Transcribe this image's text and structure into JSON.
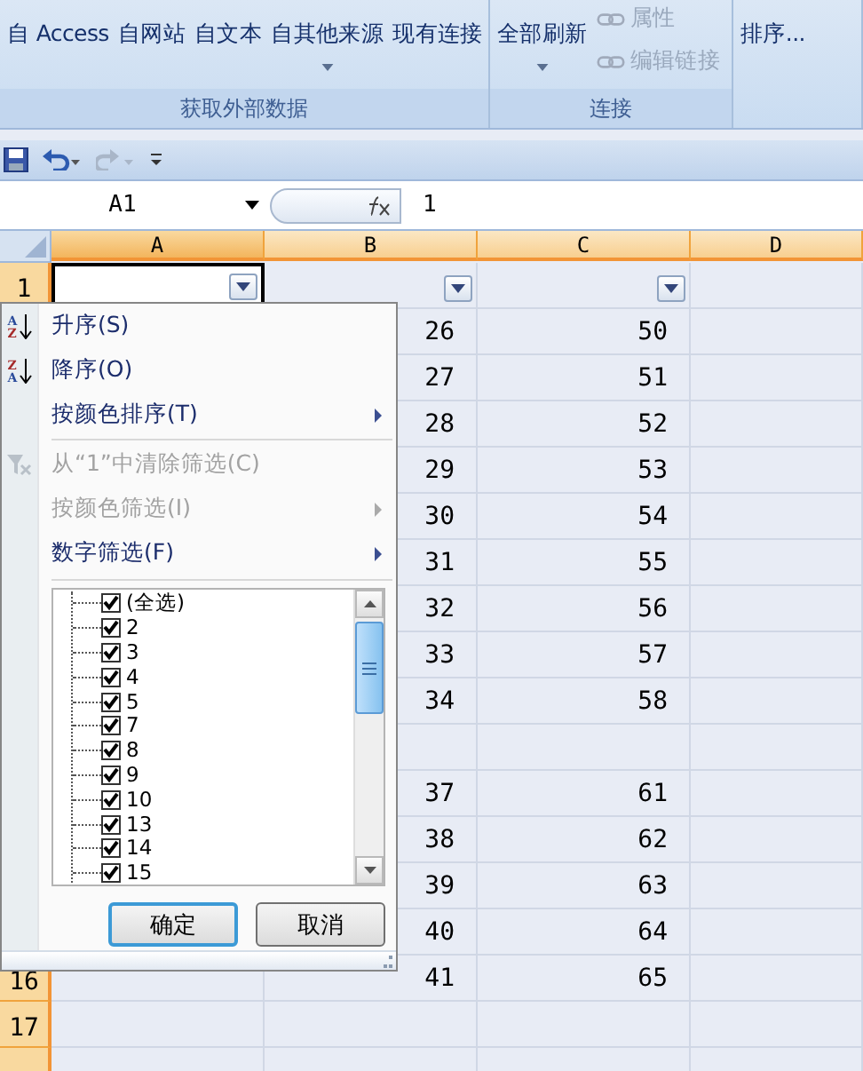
{
  "ribbon": {
    "groups": [
      {
        "label": "获取外部数据",
        "buttons": [
          {
            "label": "自 Access",
            "disabled": false,
            "dropdown": false
          },
          {
            "label": "自网站",
            "disabled": false,
            "dropdown": false
          },
          {
            "label": "自文本",
            "disabled": false,
            "dropdown": false
          },
          {
            "label": "自其他来源",
            "disabled": false,
            "dropdown": true
          },
          {
            "label": "现有连接",
            "disabled": false,
            "dropdown": false
          }
        ]
      },
      {
        "label": "连接",
        "buttons": [
          {
            "label": "全部刷新",
            "disabled": false,
            "dropdown": true
          },
          {
            "label": "属性",
            "disabled": true,
            "dropdown": false
          },
          {
            "label": "编辑链接",
            "disabled": true,
            "dropdown": false
          }
        ]
      },
      {
        "buttons": [
          {
            "label": "排序...",
            "disabled": false,
            "dropdown": false
          }
        ]
      }
    ]
  },
  "name_box": "A1",
  "formula": "1",
  "columns": [
    {
      "label": "A",
      "selected": true,
      "filter": true
    },
    {
      "label": "B",
      "selected": false,
      "filter": true
    },
    {
      "label": "C",
      "selected": false,
      "filter": true
    },
    {
      "label": "D",
      "selected": false,
      "filter": false
    }
  ],
  "rows": [
    {
      "number": "1",
      "cells": [
        {
          "active": true
        },
        {
          "active": false
        },
        {
          "active": false
        },
        {
          "active": false
        }
      ]
    },
    {
      "cells": [
        {},
        {
          "text": "26",
          "active": false
        },
        {
          "text": "50",
          "active": false
        },
        {
          "active": false
        }
      ]
    },
    {
      "cells": [
        {},
        {
          "text": "27",
          "active": false
        },
        {
          "text": "51",
          "active": false
        },
        {
          "active": false
        }
      ]
    },
    {
      "cells": [
        {},
        {
          "text": "28",
          "active": false
        },
        {
          "text": "52",
          "active": false
        },
        {
          "active": false
        }
      ]
    },
    {
      "cells": [
        {},
        {
          "text": "29",
          "active": false
        },
        {
          "text": "53",
          "active": false
        },
        {
          "active": false
        }
      ]
    },
    {
      "cells": [
        {},
        {
          "text": "30",
          "active": false
        },
        {
          "text": "54",
          "active": false
        },
        {
          "active": false
        }
      ]
    },
    {
      "cells": [
        {},
        {
          "text": "31",
          "active": false
        },
        {
          "text": "55",
          "active": false
        },
        {
          "active": false
        }
      ]
    },
    {
      "cells": [
        {},
        {
          "text": "32",
          "active": false
        },
        {
          "text": "56",
          "active": false
        },
        {
          "active": false
        }
      ]
    },
    {
      "cells": [
        {},
        {
          "text": "33",
          "active": false
        },
        {
          "text": "57",
          "active": false
        },
        {
          "active": false
        }
      ]
    },
    {
      "cells": [
        {},
        {
          "text": "34",
          "active": false
        },
        {
          "text": "58",
          "active": false
        },
        {
          "active": false
        }
      ]
    },
    {
      "cells": [
        {},
        {
          "active": false
        },
        {
          "active": false
        },
        {
          "active": false
        }
      ]
    },
    {
      "cells": [
        {},
        {
          "text": "37",
          "active": false
        },
        {
          "text": "61",
          "active": false
        },
        {
          "active": false
        }
      ]
    },
    {
      "cells": [
        {},
        {
          "text": "38",
          "active": false
        },
        {
          "text": "62",
          "active": false
        },
        {
          "active": false
        }
      ]
    },
    {
      "cells": [
        {},
        {
          "text": "39",
          "active": false
        },
        {
          "text": "63",
          "active": false
        },
        {
          "active": false
        }
      ]
    },
    {
      "cells": [
        {},
        {
          "text": "40",
          "active": false
        },
        {
          "text": "64",
          "active": false
        },
        {
          "active": false
        }
      ]
    },
    {
      "number": "16",
      "cells": [
        {
          "active": false
        },
        {
          "text": "41",
          "active": false
        },
        {
          "text": "65",
          "active": false
        },
        {
          "active": false
        }
      ]
    },
    {
      "number": "17",
      "cells": [
        {
          "active": false
        },
        {
          "active": false
        },
        {
          "active": false
        },
        {
          "active": false
        }
      ]
    },
    {
      "cells": [
        {
          "active": false
        },
        {
          "active": false
        },
        {
          "active": false
        },
        {
          "active": false
        }
      ]
    }
  ],
  "filter_menu": {
    "items": [
      {
        "kind": "sort-asc",
        "label": "升序(S)",
        "icon_letters": [
          "A",
          "Z"
        ],
        "disabled": false,
        "submenu": false
      },
      {
        "kind": "sort-desc",
        "label": "降序(O)",
        "icon_letters": [
          "Z",
          "A"
        ],
        "disabled": false,
        "submenu": false
      },
      {
        "kind": "plain",
        "label": "按颜色排序(T)",
        "disabled": false,
        "submenu": true
      },
      {
        "kind": "separator"
      },
      {
        "kind": "clear-filter",
        "label": "从“1”中清除筛选(C)",
        "disabled": true,
        "submenu": false
      },
      {
        "kind": "plain",
        "label": "按颜色筛选(I)",
        "disabled": true,
        "submenu": true
      },
      {
        "kind": "plain",
        "label": "数字筛选(F)",
        "disabled": false,
        "submenu": true
      },
      {
        "kind": "separator"
      }
    ],
    "list": [
      {
        "label": "(全选)",
        "checked": true
      },
      {
        "label": "2",
        "checked": true
      },
      {
        "label": "3",
        "checked": true
      },
      {
        "label": "4",
        "checked": true
      },
      {
        "label": "5",
        "checked": true
      },
      {
        "label": "7",
        "checked": true
      },
      {
        "label": "8",
        "checked": true
      },
      {
        "label": "9",
        "checked": true
      },
      {
        "label": "10",
        "checked": true
      },
      {
        "label": "13",
        "checked": true
      },
      {
        "label": "14",
        "checked": true
      },
      {
        "label": "15",
        "checked": true
      }
    ],
    "buttons": [
      {
        "label": "确定",
        "selected": true
      },
      {
        "label": "取消",
        "selected": false
      }
    ]
  }
}
